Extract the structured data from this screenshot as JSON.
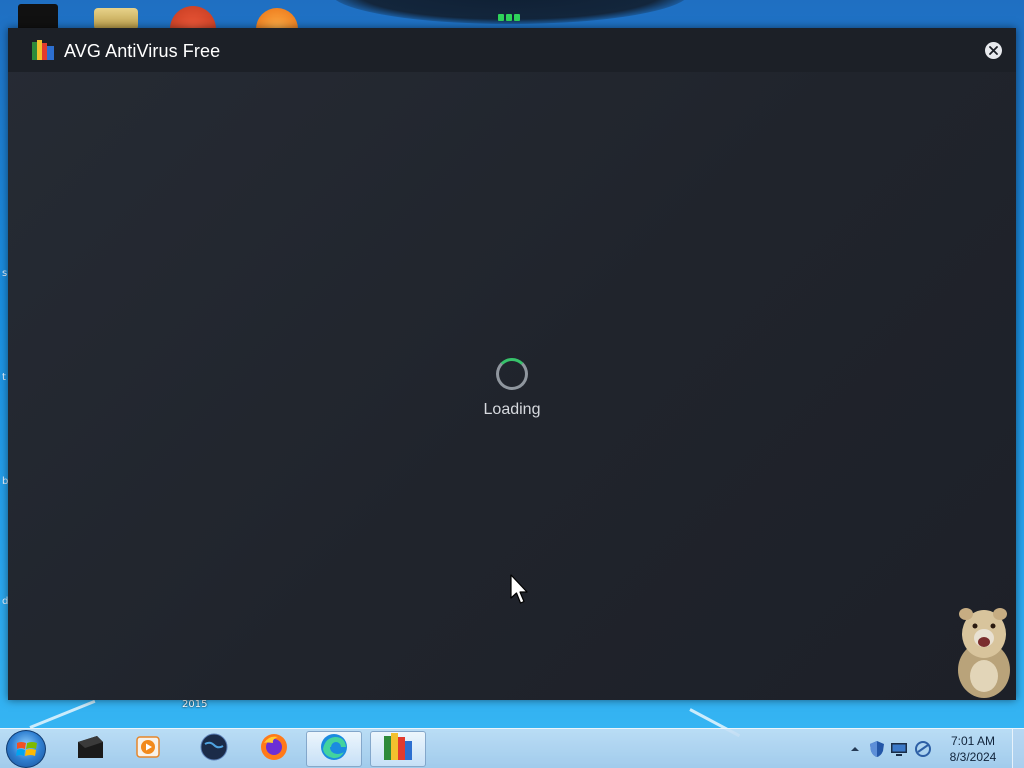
{
  "window": {
    "title": "AVG AntiVirus Free",
    "close_label": "Close",
    "logo_icon": "avg-logo-icon",
    "close_icon": "close-icon"
  },
  "main": {
    "loading_text": "Loading",
    "spinner_icon": "loading-spinner-icon",
    "accent_color": "#37c26b"
  },
  "desktop": {
    "year_label": "2015",
    "edge_glyphs": [
      "s",
      "t",
      "b",
      "d"
    ]
  },
  "taskbar": {
    "start_icon": "windows-start-icon",
    "items": [
      {
        "name": "black-box-app-icon"
      },
      {
        "name": "media-player-icon"
      },
      {
        "name": "globe-app-icon"
      },
      {
        "name": "firefox-icon"
      },
      {
        "name": "edge-icon"
      },
      {
        "name": "avg-icon"
      }
    ],
    "tray_icons": [
      "show-hidden-icons-icon",
      "security-shield-icon",
      "monitor-icon",
      "network-icon"
    ],
    "clock": {
      "time": "7:01 AM",
      "date": "8/3/2024"
    }
  }
}
